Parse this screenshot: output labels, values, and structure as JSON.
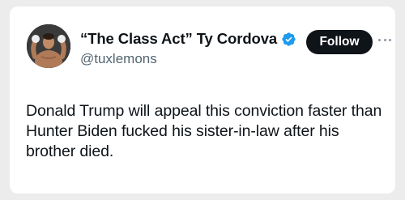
{
  "tweet": {
    "author": {
      "display_name": "“The Class Act” Ty Cordova",
      "handle": "@tuxlemons",
      "verified": true
    },
    "follow_label": "Follow",
    "text": "Donald Trump will appeal this conviction faster than Hunter Biden fucked his sister-in-law after his brother died."
  },
  "icons": {
    "verified": "verified-badge-icon",
    "more": "more-horizontal-icon"
  },
  "colors": {
    "verified_blue": "#1d9bf0",
    "follow_bg": "#0f1419",
    "text": "#0f1419",
    "muted": "#536471"
  }
}
